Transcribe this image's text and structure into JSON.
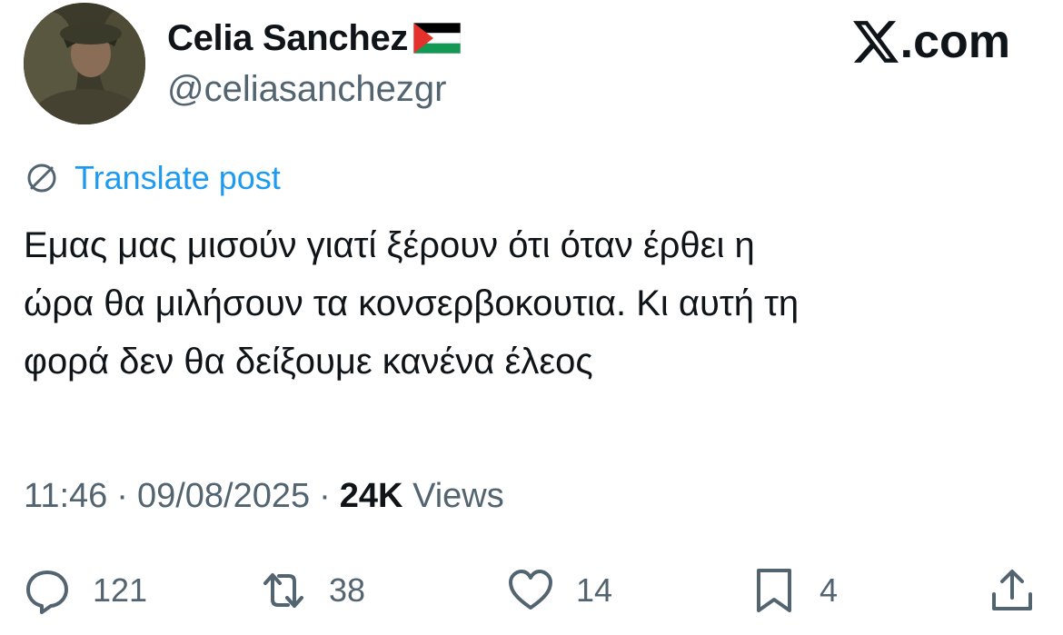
{
  "author": {
    "display_name": "Celia Sanchez",
    "handle": "@celiasanchezgr",
    "flag_icon": "palestine-flag-emoji"
  },
  "brand": {
    "label": ".com",
    "logo_icon": "x-logo-icon"
  },
  "translate": {
    "label": "Translate post",
    "icon": "globe-icon"
  },
  "post": {
    "text": "Εμας μας μισούν γιατί ξέρουν ότι όταν έρθει η\nώρα θα μιλήσουν τα κονσερβοκουτια. Κι αυτή τη\nφορά δεν θα δείξουμε κανένα έλεος"
  },
  "meta": {
    "time": "11:46",
    "separator": "·",
    "date": "09/08/2025",
    "views_count": "24K",
    "views_label": "Views"
  },
  "actions": {
    "replies": {
      "count": "121",
      "icon": "reply-icon"
    },
    "reposts": {
      "count": "38",
      "icon": "repost-icon"
    },
    "likes": {
      "count": "14",
      "icon": "heart-icon"
    },
    "bookmarks": {
      "count": "4",
      "icon": "bookmark-icon"
    },
    "share": {
      "icon": "share-icon"
    }
  },
  "colors": {
    "text": "#0f1419",
    "secondary": "#536471",
    "link": "#1d9bf0"
  }
}
